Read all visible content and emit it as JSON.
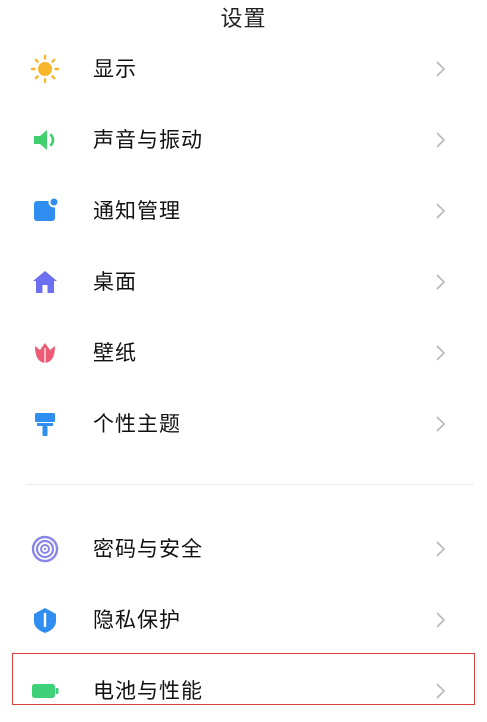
{
  "header": {
    "title": "设置"
  },
  "settings": {
    "items": [
      {
        "label": "显示",
        "icon": "sun-icon"
      },
      {
        "label": "声音与振动",
        "icon": "speaker-icon"
      },
      {
        "label": "通知管理",
        "icon": "notification-icon"
      },
      {
        "label": "桌面",
        "icon": "home-icon"
      },
      {
        "label": "壁纸",
        "icon": "tulip-icon"
      },
      {
        "label": "个性主题",
        "icon": "paint-roller-icon"
      },
      {
        "label": "密码与安全",
        "icon": "fingerprint-icon"
      },
      {
        "label": "隐私保护",
        "icon": "shield-icon"
      },
      {
        "label": "电池与性能",
        "icon": "battery-icon"
      }
    ]
  },
  "colors": {
    "sun": "#f7b52c",
    "speaker": "#3fcf6e",
    "notification": "#2f8ef0",
    "home": "#6c6ff0",
    "tulip": "#ee5b74",
    "theme": "#2f8ef0",
    "fingerprint": "#8a86e8",
    "shield": "#2f8ef0",
    "battery": "#3fd07a",
    "chevron": "#b8b8b8",
    "highlight": "#d9413d"
  }
}
